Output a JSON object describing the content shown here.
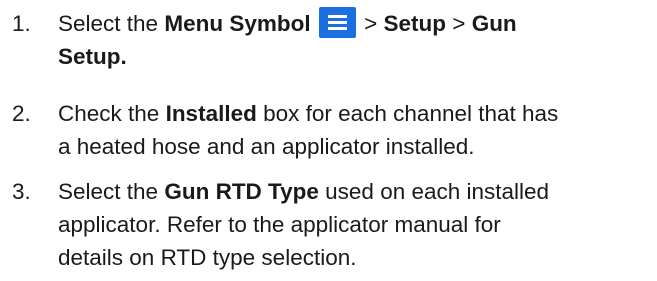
{
  "steps": [
    {
      "number": "1.",
      "lead": "Select the ",
      "menu_symbol": "Menu Symbol",
      "sep1": " > ",
      "setup": "Setup",
      "sep2": " > ",
      "gun": "Gun",
      "gun_setup_end": "Setup.",
      "icon": "hamburger-menu-icon",
      "icon_color": "#1b6fe0"
    },
    {
      "number": "2.",
      "lead": "Check the ",
      "installed": "Installed",
      "rest1": " box for each channel that has",
      "line2": "a heated hose and an applicator installed."
    },
    {
      "number": "3.",
      "lead": "Select the ",
      "gun_rtd_type": "Gun RTD Type",
      "rest1": " used on each installed",
      "line2": "applicator. Refer to the applicator manual for",
      "line3": "details on RTD type selection."
    }
  ]
}
